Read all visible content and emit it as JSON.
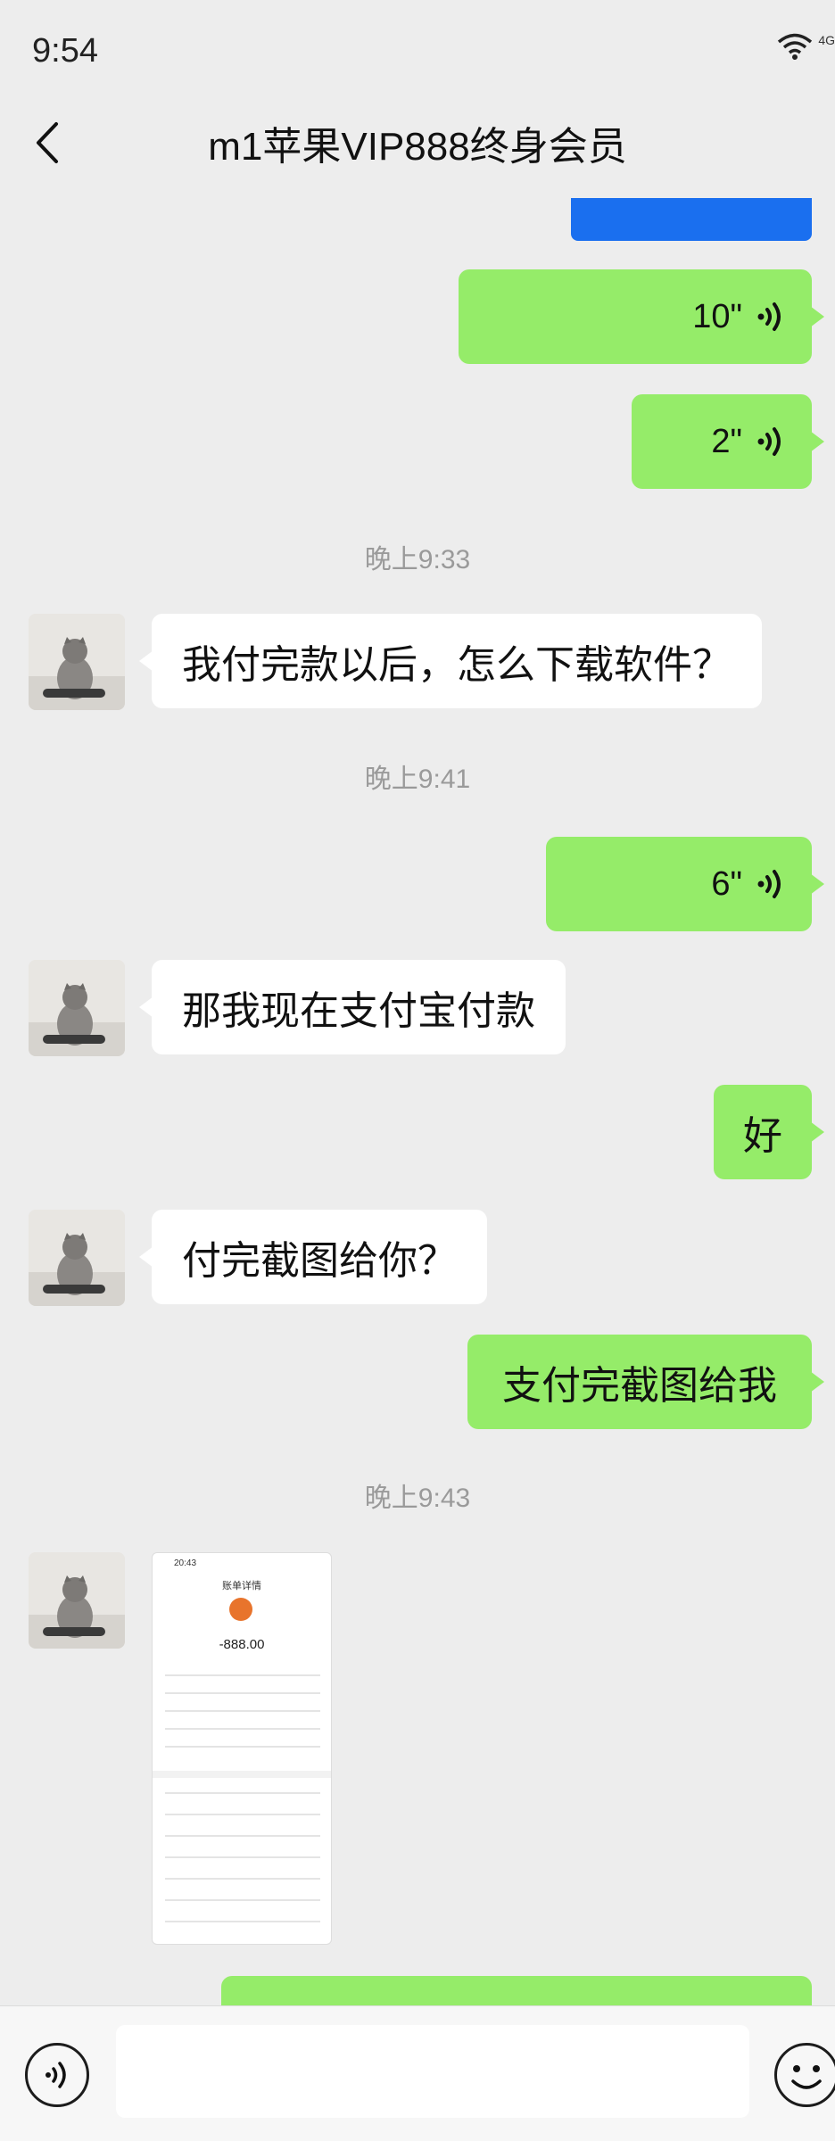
{
  "status_bar": {
    "time": "9:54",
    "network": "4G"
  },
  "header": {
    "title": "m1苹果VIP888终身会员"
  },
  "messages": {
    "voice1": {
      "duration": "10\""
    },
    "voice2": {
      "duration": "2\""
    },
    "ts1": "晚上9:33",
    "msg1": "我付完款以后，怎么下载软件？",
    "ts2": "晚上9:41",
    "voice3": {
      "duration": "6\""
    },
    "msg2": "那我现在支付宝付款",
    "msg3": "好",
    "msg4": "付完截图给你？",
    "msg5": "支付完截图给我",
    "ts3": "晚上9:43",
    "shot": {
      "time": "20:43",
      "title": "账单详情",
      "amount": "-888.00"
    }
  },
  "colors": {
    "outgoing_bubble": "#95ec69",
    "incoming_bubble": "#ffffff",
    "background": "#ededed",
    "blue_strip": "#1a6fef"
  },
  "icons": {
    "back": "chevron-left-icon",
    "voice_wave": "voice-wave-icon",
    "voice_input": "voice-input-icon",
    "emoji": "emoji-icon",
    "wifi": "wifi-icon"
  }
}
